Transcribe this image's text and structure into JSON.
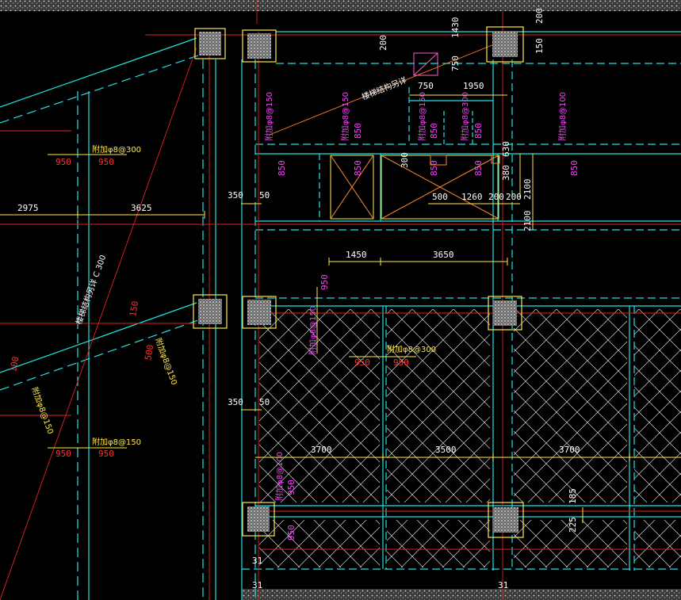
{
  "drawing": {
    "dimensions": {
      "d_2975": "2975",
      "d_3625": "3625",
      "d_350_top": "350",
      "d_50_top": "50",
      "d_350_bot": "350",
      "d_50_bot": "50",
      "d_1450": "1450",
      "d_3650": "3650",
      "d_3700_a": "3700",
      "d_3500": "3500",
      "d_3700_b": "3700",
      "d_750": "750",
      "d_1950": "1950",
      "d_750_v": "750",
      "d_1430": "1430",
      "d_200_top": "200",
      "d_200_right": "200",
      "d_150": "150",
      "d_500": "500",
      "d_1260": "1260",
      "d_200_a": "200",
      "d_200_b": "200",
      "d_300": "300",
      "d_380": "380",
      "d_630": "630",
      "d_2100_a": "2100",
      "d_2100_b": "2100",
      "d_185": "185",
      "d_225": "225",
      "d_31_a": "31",
      "d_31_b": "31",
      "d_31_c": "31"
    },
    "rebar_labels": {
      "r1": "附加φ8@300",
      "r2": "附加φ8@150",
      "r3": "附加φ8@300",
      "r4": "附加φ8@150",
      "r5": "附加φ8@150",
      "r6": "附加φ8@150",
      "r7": "附加φ8@300",
      "r8": "附加φ8@100",
      "r9": "附加φ8@150",
      "r10": "附加φ8@100",
      "r11": "附加φ8@150",
      "r12": "附加φ8@150"
    },
    "lengths": {
      "l950_a": "950",
      "l950_b": "950",
      "l950_c": "950",
      "l950_d": "950",
      "l950_e": "950",
      "l950_f": "950",
      "l850_a": "850",
      "l850_b": "850",
      "l850_c": "850",
      "l850_d": "850",
      "l850_e": "850",
      "l850_f": "850",
      "l850_g": "850",
      "l950_v1": "950",
      "l950_v2": "950",
      "l950_v3": "950",
      "l100": "100",
      "l150": "150",
      "l500": "500",
      "l850_h": "850"
    },
    "notes": {
      "stair_top": "楼梯结构另详",
      "stair_diag": "楼梯结构另详 C 300"
    }
  }
}
